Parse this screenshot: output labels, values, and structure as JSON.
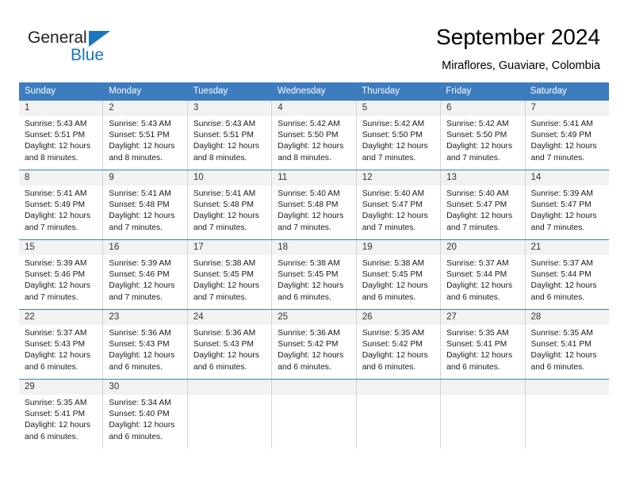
{
  "brand": {
    "name_part1": "General",
    "name_part2": "Blue",
    "accent_color": "#1b75bb"
  },
  "header": {
    "title": "September 2024",
    "subtitle": "Miraflores, Guaviare, Colombia"
  },
  "calendar": {
    "header_bg": "#3d7cbf",
    "weekdays": [
      "Sunday",
      "Monday",
      "Tuesday",
      "Wednesday",
      "Thursday",
      "Friday",
      "Saturday"
    ],
    "weeks": [
      [
        {
          "day": "1",
          "sunrise": "Sunrise: 5:43 AM",
          "sunset": "Sunset: 5:51 PM",
          "daylight1": "Daylight: 12 hours",
          "daylight2": "and 8 minutes."
        },
        {
          "day": "2",
          "sunrise": "Sunrise: 5:43 AM",
          "sunset": "Sunset: 5:51 PM",
          "daylight1": "Daylight: 12 hours",
          "daylight2": "and 8 minutes."
        },
        {
          "day": "3",
          "sunrise": "Sunrise: 5:43 AM",
          "sunset": "Sunset: 5:51 PM",
          "daylight1": "Daylight: 12 hours",
          "daylight2": "and 8 minutes."
        },
        {
          "day": "4",
          "sunrise": "Sunrise: 5:42 AM",
          "sunset": "Sunset: 5:50 PM",
          "daylight1": "Daylight: 12 hours",
          "daylight2": "and 8 minutes."
        },
        {
          "day": "5",
          "sunrise": "Sunrise: 5:42 AM",
          "sunset": "Sunset: 5:50 PM",
          "daylight1": "Daylight: 12 hours",
          "daylight2": "and 7 minutes."
        },
        {
          "day": "6",
          "sunrise": "Sunrise: 5:42 AM",
          "sunset": "Sunset: 5:50 PM",
          "daylight1": "Daylight: 12 hours",
          "daylight2": "and 7 minutes."
        },
        {
          "day": "7",
          "sunrise": "Sunrise: 5:41 AM",
          "sunset": "Sunset: 5:49 PM",
          "daylight1": "Daylight: 12 hours",
          "daylight2": "and 7 minutes."
        }
      ],
      [
        {
          "day": "8",
          "sunrise": "Sunrise: 5:41 AM",
          "sunset": "Sunset: 5:49 PM",
          "daylight1": "Daylight: 12 hours",
          "daylight2": "and 7 minutes."
        },
        {
          "day": "9",
          "sunrise": "Sunrise: 5:41 AM",
          "sunset": "Sunset: 5:48 PM",
          "daylight1": "Daylight: 12 hours",
          "daylight2": "and 7 minutes."
        },
        {
          "day": "10",
          "sunrise": "Sunrise: 5:41 AM",
          "sunset": "Sunset: 5:48 PM",
          "daylight1": "Daylight: 12 hours",
          "daylight2": "and 7 minutes."
        },
        {
          "day": "11",
          "sunrise": "Sunrise: 5:40 AM",
          "sunset": "Sunset: 5:48 PM",
          "daylight1": "Daylight: 12 hours",
          "daylight2": "and 7 minutes."
        },
        {
          "day": "12",
          "sunrise": "Sunrise: 5:40 AM",
          "sunset": "Sunset: 5:47 PM",
          "daylight1": "Daylight: 12 hours",
          "daylight2": "and 7 minutes."
        },
        {
          "day": "13",
          "sunrise": "Sunrise: 5:40 AM",
          "sunset": "Sunset: 5:47 PM",
          "daylight1": "Daylight: 12 hours",
          "daylight2": "and 7 minutes."
        },
        {
          "day": "14",
          "sunrise": "Sunrise: 5:39 AM",
          "sunset": "Sunset: 5:47 PM",
          "daylight1": "Daylight: 12 hours",
          "daylight2": "and 7 minutes."
        }
      ],
      [
        {
          "day": "15",
          "sunrise": "Sunrise: 5:39 AM",
          "sunset": "Sunset: 5:46 PM",
          "daylight1": "Daylight: 12 hours",
          "daylight2": "and 7 minutes."
        },
        {
          "day": "16",
          "sunrise": "Sunrise: 5:39 AM",
          "sunset": "Sunset: 5:46 PM",
          "daylight1": "Daylight: 12 hours",
          "daylight2": "and 7 minutes."
        },
        {
          "day": "17",
          "sunrise": "Sunrise: 5:38 AM",
          "sunset": "Sunset: 5:45 PM",
          "daylight1": "Daylight: 12 hours",
          "daylight2": "and 7 minutes."
        },
        {
          "day": "18",
          "sunrise": "Sunrise: 5:38 AM",
          "sunset": "Sunset: 5:45 PM",
          "daylight1": "Daylight: 12 hours",
          "daylight2": "and 6 minutes."
        },
        {
          "day": "19",
          "sunrise": "Sunrise: 5:38 AM",
          "sunset": "Sunset: 5:45 PM",
          "daylight1": "Daylight: 12 hours",
          "daylight2": "and 6 minutes."
        },
        {
          "day": "20",
          "sunrise": "Sunrise: 5:37 AM",
          "sunset": "Sunset: 5:44 PM",
          "daylight1": "Daylight: 12 hours",
          "daylight2": "and 6 minutes."
        },
        {
          "day": "21",
          "sunrise": "Sunrise: 5:37 AM",
          "sunset": "Sunset: 5:44 PM",
          "daylight1": "Daylight: 12 hours",
          "daylight2": "and 6 minutes."
        }
      ],
      [
        {
          "day": "22",
          "sunrise": "Sunrise: 5:37 AM",
          "sunset": "Sunset: 5:43 PM",
          "daylight1": "Daylight: 12 hours",
          "daylight2": "and 6 minutes."
        },
        {
          "day": "23",
          "sunrise": "Sunrise: 5:36 AM",
          "sunset": "Sunset: 5:43 PM",
          "daylight1": "Daylight: 12 hours",
          "daylight2": "and 6 minutes."
        },
        {
          "day": "24",
          "sunrise": "Sunrise: 5:36 AM",
          "sunset": "Sunset: 5:43 PM",
          "daylight1": "Daylight: 12 hours",
          "daylight2": "and 6 minutes."
        },
        {
          "day": "25",
          "sunrise": "Sunrise: 5:36 AM",
          "sunset": "Sunset: 5:42 PM",
          "daylight1": "Daylight: 12 hours",
          "daylight2": "and 6 minutes."
        },
        {
          "day": "26",
          "sunrise": "Sunrise: 5:35 AM",
          "sunset": "Sunset: 5:42 PM",
          "daylight1": "Daylight: 12 hours",
          "daylight2": "and 6 minutes."
        },
        {
          "day": "27",
          "sunrise": "Sunrise: 5:35 AM",
          "sunset": "Sunset: 5:41 PM",
          "daylight1": "Daylight: 12 hours",
          "daylight2": "and 6 minutes."
        },
        {
          "day": "28",
          "sunrise": "Sunrise: 5:35 AM",
          "sunset": "Sunset: 5:41 PM",
          "daylight1": "Daylight: 12 hours",
          "daylight2": "and 6 minutes."
        }
      ],
      [
        {
          "day": "29",
          "sunrise": "Sunrise: 5:35 AM",
          "sunset": "Sunset: 5:41 PM",
          "daylight1": "Daylight: 12 hours",
          "daylight2": "and 6 minutes."
        },
        {
          "day": "30",
          "sunrise": "Sunrise: 5:34 AM",
          "sunset": "Sunset: 5:40 PM",
          "daylight1": "Daylight: 12 hours",
          "daylight2": "and 6 minutes."
        },
        {
          "day": "",
          "sunrise": "",
          "sunset": "",
          "daylight1": "",
          "daylight2": ""
        },
        {
          "day": "",
          "sunrise": "",
          "sunset": "",
          "daylight1": "",
          "daylight2": ""
        },
        {
          "day": "",
          "sunrise": "",
          "sunset": "",
          "daylight1": "",
          "daylight2": ""
        },
        {
          "day": "",
          "sunrise": "",
          "sunset": "",
          "daylight1": "",
          "daylight2": ""
        },
        {
          "day": "",
          "sunrise": "",
          "sunset": "",
          "daylight1": "",
          "daylight2": ""
        }
      ]
    ]
  }
}
